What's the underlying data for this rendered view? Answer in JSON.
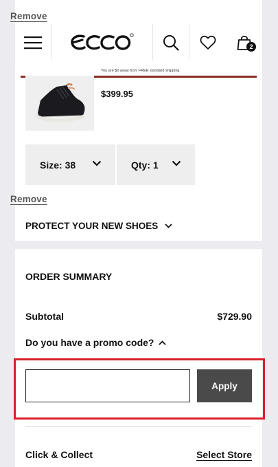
{
  "cart": {
    "remove_label": "Remove"
  },
  "header": {
    "brand": "ecco",
    "bag_count": "2",
    "icons": {
      "menu": "hamburger-menu-icon",
      "search": "search-icon",
      "favorites": "heart-icon",
      "bag": "shopping-bag-icon"
    },
    "shipping_message": "You are $0 away from FREE standard shipping",
    "shipping_progress": 1.0,
    "shipping_bar_color": "#8a2b22"
  },
  "product": {
    "price": "$399.95",
    "size_label": "Size: 38",
    "qty_label": "Qty: 1",
    "remove_label": "Remove",
    "protect_label": "PROTECT YOUR NEW SHOES"
  },
  "summary": {
    "title": "ORDER SUMMARY",
    "subtotal_label": "Subtotal",
    "subtotal_value": "$729.90",
    "promo_question": "Do you have a promo code?",
    "promo_value": "",
    "apply_label": "Apply",
    "click_collect_label": "Click & Collect",
    "select_store_label": "Select Store"
  },
  "colors": {
    "highlight": "#d9202b",
    "apply_button": "#4a4a4a",
    "page_background": "#ececf0"
  }
}
